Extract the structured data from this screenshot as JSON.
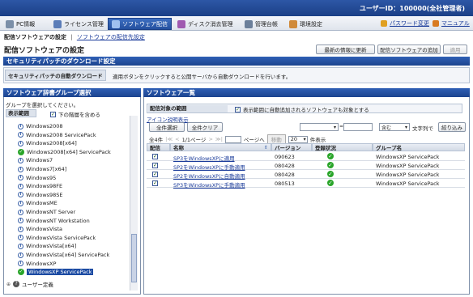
{
  "header": {
    "user_id": "ユーザーID：100000(全社管理者)"
  },
  "nav": {
    "tabs": [
      {
        "label": "PC情報"
      },
      {
        "label": "ライセンス管理"
      },
      {
        "label": "ソフトウェア配信"
      },
      {
        "label": "ディスク消去管理"
      },
      {
        "label": "管理台帳"
      },
      {
        "label": "環境設定"
      }
    ],
    "password_link": "パスワード変更",
    "manual_link": "マニュアル"
  },
  "breadcrumb": {
    "current": "配信ソフトウェアの設定",
    "separator": "|",
    "link": "ソフトウェアの配信先設定"
  },
  "page_title": "配信ソフトウェアの設定",
  "buttons": {
    "refresh": "最新の情報に更新",
    "add": "配信ソフトウェアの追加",
    "apply": "適用"
  },
  "download_section": {
    "title": "セキュリティパッチのダウンロード設定",
    "label": "セキュリティパッチの自動ダウンロード",
    "description": "適用ボタンをクリックすると公開サーバから自動ダウンロードを行います。"
  },
  "left_panel": {
    "title": "ソフトウェア辞書グループ選択",
    "instruction": "グループを選択してください。",
    "range_label": "表示範囲",
    "include_sub": "下の階層を含める",
    "tree": [
      {
        "label": "Windows2008",
        "icon": "info"
      },
      {
        "label": "Windows2008 ServicePack",
        "icon": "info"
      },
      {
        "label": "Windows2008[x64]",
        "icon": "info"
      },
      {
        "label": "Windows2008[x64] ServicePack",
        "icon": "ok"
      },
      {
        "label": "Windows7",
        "icon": "info"
      },
      {
        "label": "Windows7[x64]",
        "icon": "info"
      },
      {
        "label": "Windows95",
        "icon": "info"
      },
      {
        "label": "Windows98FE",
        "icon": "info"
      },
      {
        "label": "Windows98SE",
        "icon": "info"
      },
      {
        "label": "WindowsME",
        "icon": "info"
      },
      {
        "label": "WindowsNT Server",
        "icon": "info"
      },
      {
        "label": "WindowsNT Workstation",
        "icon": "info"
      },
      {
        "label": "WindowsVista",
        "icon": "info"
      },
      {
        "label": "WindowsVista ServicePack",
        "icon": "info"
      },
      {
        "label": "WindowsVista[x64]",
        "icon": "info"
      },
      {
        "label": "WindowsVista[x64] ServicePack",
        "icon": "info"
      },
      {
        "label": "WindowsXP",
        "icon": "info"
      },
      {
        "label": "WindowsXP ServicePack",
        "icon": "ok",
        "selected": true
      }
    ],
    "user_defined": "ユーザー定義"
  },
  "right_panel": {
    "title": "ソフトウェア一覧",
    "scope_label": "配信対象の範囲",
    "scope_check": "表示範囲に自動追加されるソフトウェアも対象とする",
    "icon_legend": "アイコン説明表示",
    "select_all": "全件選択",
    "clear_all": "全件クリア",
    "filter_op": "含む",
    "filter_suffix": "文字列で",
    "filter_button": "絞り込み",
    "count": "全4件",
    "page_info": "1/1ページ",
    "page_suffix": "ページへ",
    "move": "移動",
    "per_page": "20",
    "per_page_suffix": "件表示",
    "columns": [
      "配信",
      "名称",
      "バージョン",
      "登録状況",
      "グループ名"
    ],
    "rows": [
      {
        "name": "SP3をWindowsXPに適用",
        "version": "090623",
        "group": "WindowsXP ServicePack"
      },
      {
        "name": "SP2をWindowsXPに手動適用",
        "version": "080428",
        "group": "WindowsXP ServicePack"
      },
      {
        "name": "SP2をWindowsXPに自動適用",
        "version": "080428",
        "group": "WindowsXP ServicePack"
      },
      {
        "name": "SP3をWindowsXPに手動適用",
        "version": "080513",
        "group": "WindowsXP ServicePack"
      }
    ]
  }
}
